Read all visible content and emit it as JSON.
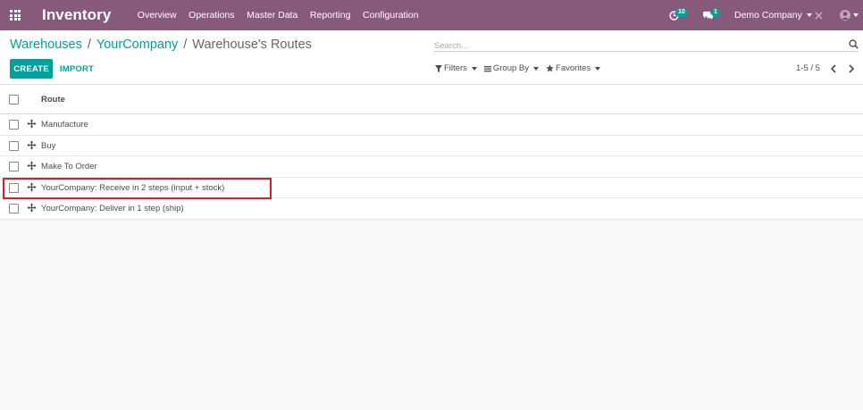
{
  "navbar": {
    "app_title": "Inventory",
    "menu": [
      "Overview",
      "Operations",
      "Master Data",
      "Reporting",
      "Configuration"
    ],
    "activity_count": "10",
    "messages_count": "1",
    "company": "Demo Company"
  },
  "breadcrumb": {
    "items": [
      "Warehouses",
      "YourCompany"
    ],
    "separator": "/",
    "current": "Warehouse's Routes"
  },
  "search": {
    "placeholder": "Search..."
  },
  "buttons": {
    "create": "CREATE",
    "import": "IMPORT"
  },
  "filters": {
    "filters": "Filters",
    "group_by": "Group By",
    "favorites": "Favorites"
  },
  "pager": {
    "value": "1-5 / 5"
  },
  "list": {
    "column": "Route",
    "rows": [
      "Manufacture",
      "Buy",
      "Make To Order",
      "YourCompany: Receive in 2 steps (input + stock)",
      "YourCompany: Deliver in 1 step (ship)"
    ]
  },
  "colors": {
    "navbar": "#875a7b",
    "accent": "#00a09d",
    "highlight": "#d0202e"
  }
}
